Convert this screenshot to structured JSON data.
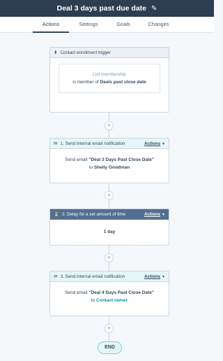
{
  "header": {
    "title": "Deal 3 days past due date",
    "edit_icon": "pencil-icon"
  },
  "tabs": [
    {
      "label": "Actions",
      "active": true
    },
    {
      "label": "Settings",
      "active": false
    },
    {
      "label": "Goals",
      "active": false
    },
    {
      "label": "Changes",
      "active": false
    }
  ],
  "trigger": {
    "icon": "download-icon",
    "title": "Contact enrollment trigger",
    "filter_type": "List membership",
    "criteria_prefix": "is member of",
    "criteria_value": "Deals past close date"
  },
  "steps": [
    {
      "icon": "envelope-icon",
      "title": "1. Send internal email notification",
      "actions_label": "Actions",
      "line1_prefix": "Send email",
      "line1_value": "\"Deal 3 Days Past Close Date\"",
      "line2_prefix": "to",
      "line2_value": "Shelly Goodman"
    },
    {
      "icon": "hourglass-icon",
      "title": "2. Delay for a set amount of time",
      "actions_label": "Actions",
      "value": "1 day"
    },
    {
      "icon": "envelope-icon",
      "title": "3. Send internal email notification",
      "actions_label": "Actions",
      "line1_prefix": "Send email",
      "line1_value": "\"Deal 4 Days Past Close Date\"",
      "line2_prefix": "to",
      "line2_value": "Contact owner"
    }
  ],
  "add_label": "+",
  "end_label": "END"
}
